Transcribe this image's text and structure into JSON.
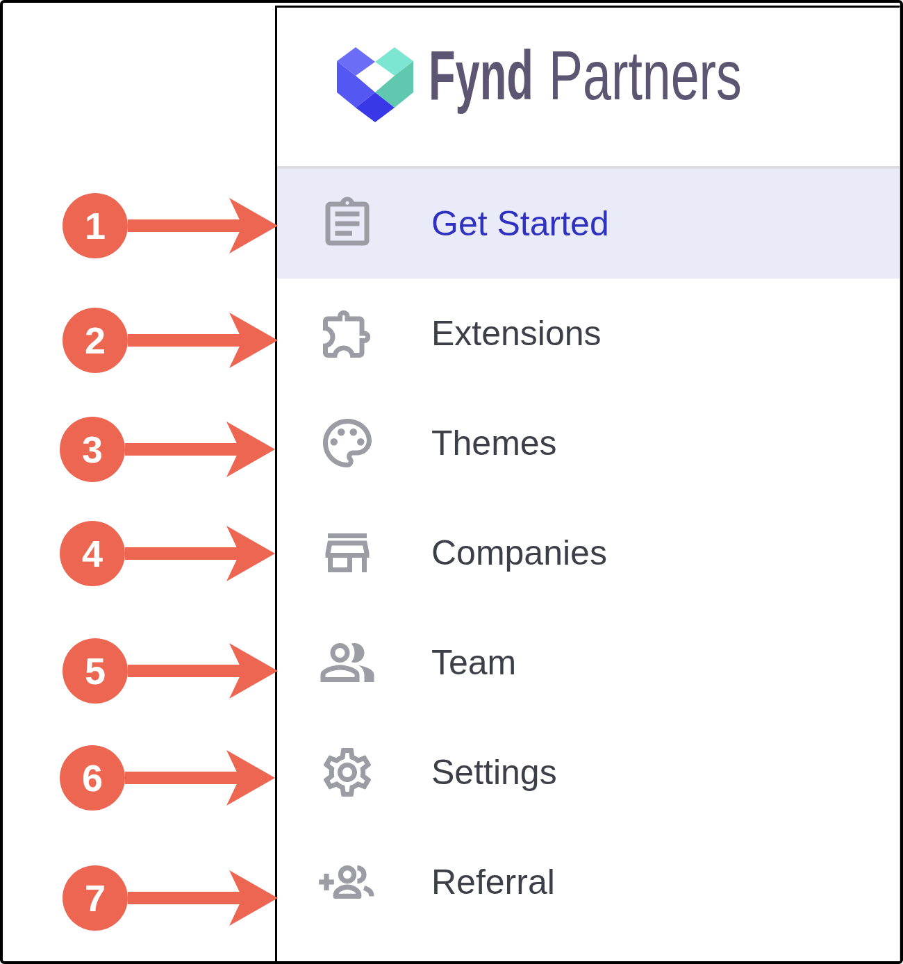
{
  "logo": {
    "name": "Fynd",
    "product": "Partners"
  },
  "nav": [
    {
      "label": "Get Started",
      "selected": true
    },
    {
      "label": "Extensions",
      "selected": false
    },
    {
      "label": "Themes",
      "selected": false
    },
    {
      "label": "Companies",
      "selected": false
    },
    {
      "label": "Team",
      "selected": false
    },
    {
      "label": "Settings",
      "selected": false
    },
    {
      "label": "Referral",
      "selected": false
    }
  ],
  "callouts": [
    {
      "label": "1"
    },
    {
      "label": "2"
    },
    {
      "label": "3"
    },
    {
      "label": "4"
    },
    {
      "label": "5"
    },
    {
      "label": "6"
    },
    {
      "label": "7"
    }
  ]
}
